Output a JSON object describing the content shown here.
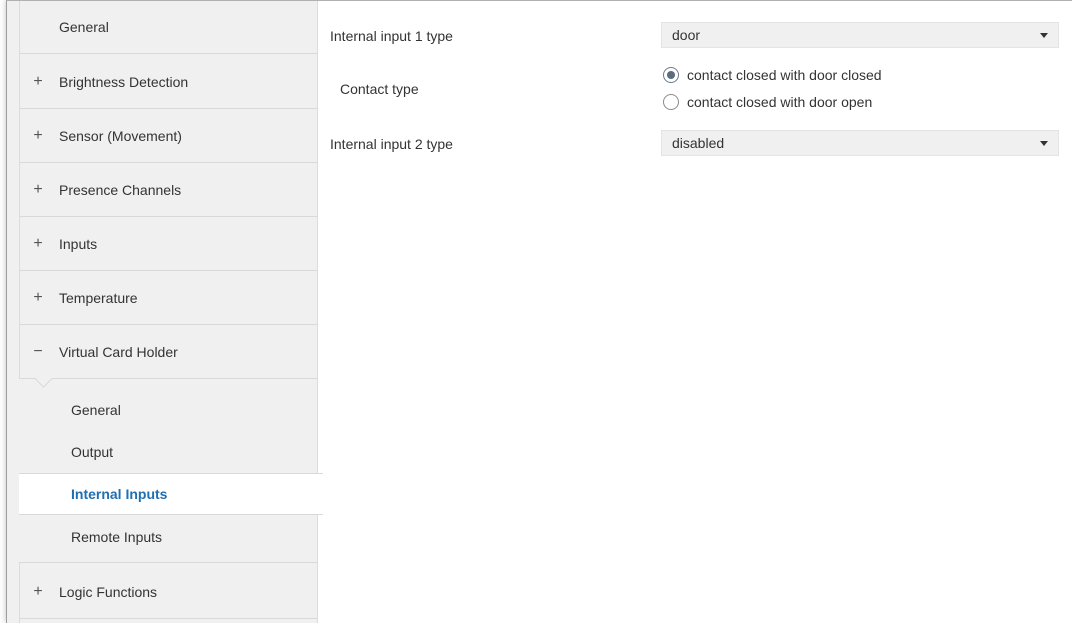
{
  "sidebar": {
    "items": [
      {
        "toggle": "",
        "label": "General"
      },
      {
        "toggle": "+",
        "label": "Brightness Detection"
      },
      {
        "toggle": "+",
        "label": "Sensor (Movement)"
      },
      {
        "toggle": "+",
        "label": "Presence Channels"
      },
      {
        "toggle": "+",
        "label": "Inputs"
      },
      {
        "toggle": "+",
        "label": "Temperature"
      },
      {
        "toggle": "−",
        "label": "Virtual Card Holder"
      }
    ],
    "sub_items": [
      {
        "label": "General"
      },
      {
        "label": "Output"
      },
      {
        "label": "Internal Inputs"
      },
      {
        "label": "Remote Inputs"
      }
    ],
    "bottom_item": {
      "toggle": "+",
      "label": "Logic Functions"
    }
  },
  "form": {
    "input1": {
      "label": "Internal input 1 type",
      "value": "door"
    },
    "contact": {
      "label": "Contact type",
      "options": [
        "contact closed with door closed",
        "contact closed with door open"
      ],
      "selected": "contact closed with door closed"
    },
    "input2": {
      "label": "Internal input 2 type",
      "value": "disabled"
    }
  },
  "colors": {
    "active_link": "#1f6fb2",
    "sidebar_bg": "#f0f0f0"
  }
}
